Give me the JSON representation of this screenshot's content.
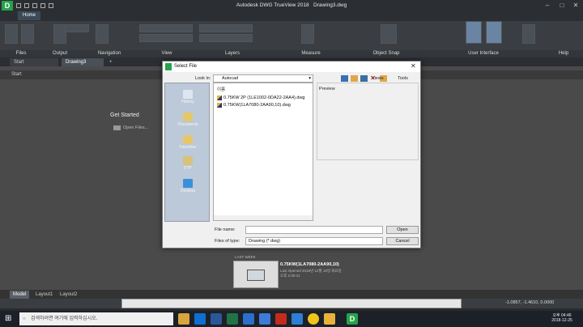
{
  "app": {
    "title": "Autodesk DWG TrueView 2018",
    "document": "Drawing3.dwg",
    "logo_letter": "D",
    "home_tab": "Home"
  },
  "ribbon_panels": [
    "Files",
    "Output",
    "Navigation",
    "View",
    "Layers",
    "Measure",
    "Object Snap",
    "User Interface",
    "Help"
  ],
  "doc_tabs": {
    "start": "Start",
    "drawing": "Drawing3",
    "add": "+"
  },
  "start_page": {
    "bar_label": "Start",
    "get_started": "Get Started",
    "open_files": "Open Files...",
    "last_week": "LAST WEEK",
    "recent_name": "0.75KW(1LA7080-2AA90,10)",
    "recent_opened": "Last Opened 2018년 12월 18일 화요일",
    "recent_time": "오후 2:30:41"
  },
  "dialog": {
    "title": "Select File",
    "look_in_label": "Look in:",
    "look_in_value": "Autocad",
    "views_label": "Views",
    "tools_label": "Tools",
    "name_header": "이름",
    "preview_label": "Preview",
    "files": [
      "0.75KW 2P (1LE1002-0DA22-2AA4).dwg",
      "0.75KW(1LA7080-2AA90,10).dwg"
    ],
    "places": [
      "History",
      "Documents",
      "Favorites",
      "FTP",
      "Desktop"
    ],
    "file_name_label": "File name:",
    "file_name_value": "",
    "files_of_type_label": "Files of type:",
    "files_of_type_value": "Drawing (*.dwg)",
    "open_button": "Open",
    "cancel_button": "Cancel"
  },
  "layout_tabs": [
    "Model",
    "Layout1",
    "Layout2"
  ],
  "status": {
    "coordinates": "-1.0857, -1.4610, 0.0000"
  },
  "taskbar": {
    "search_placeholder": "검색하려면 여기에 입력하십시오.",
    "time": "오후 04:46",
    "date": "2018-12-25"
  },
  "colors": {
    "accent": "#27a34a",
    "dialog_bg": "#f0f0f0",
    "places_bg": "#bcc9d8"
  }
}
